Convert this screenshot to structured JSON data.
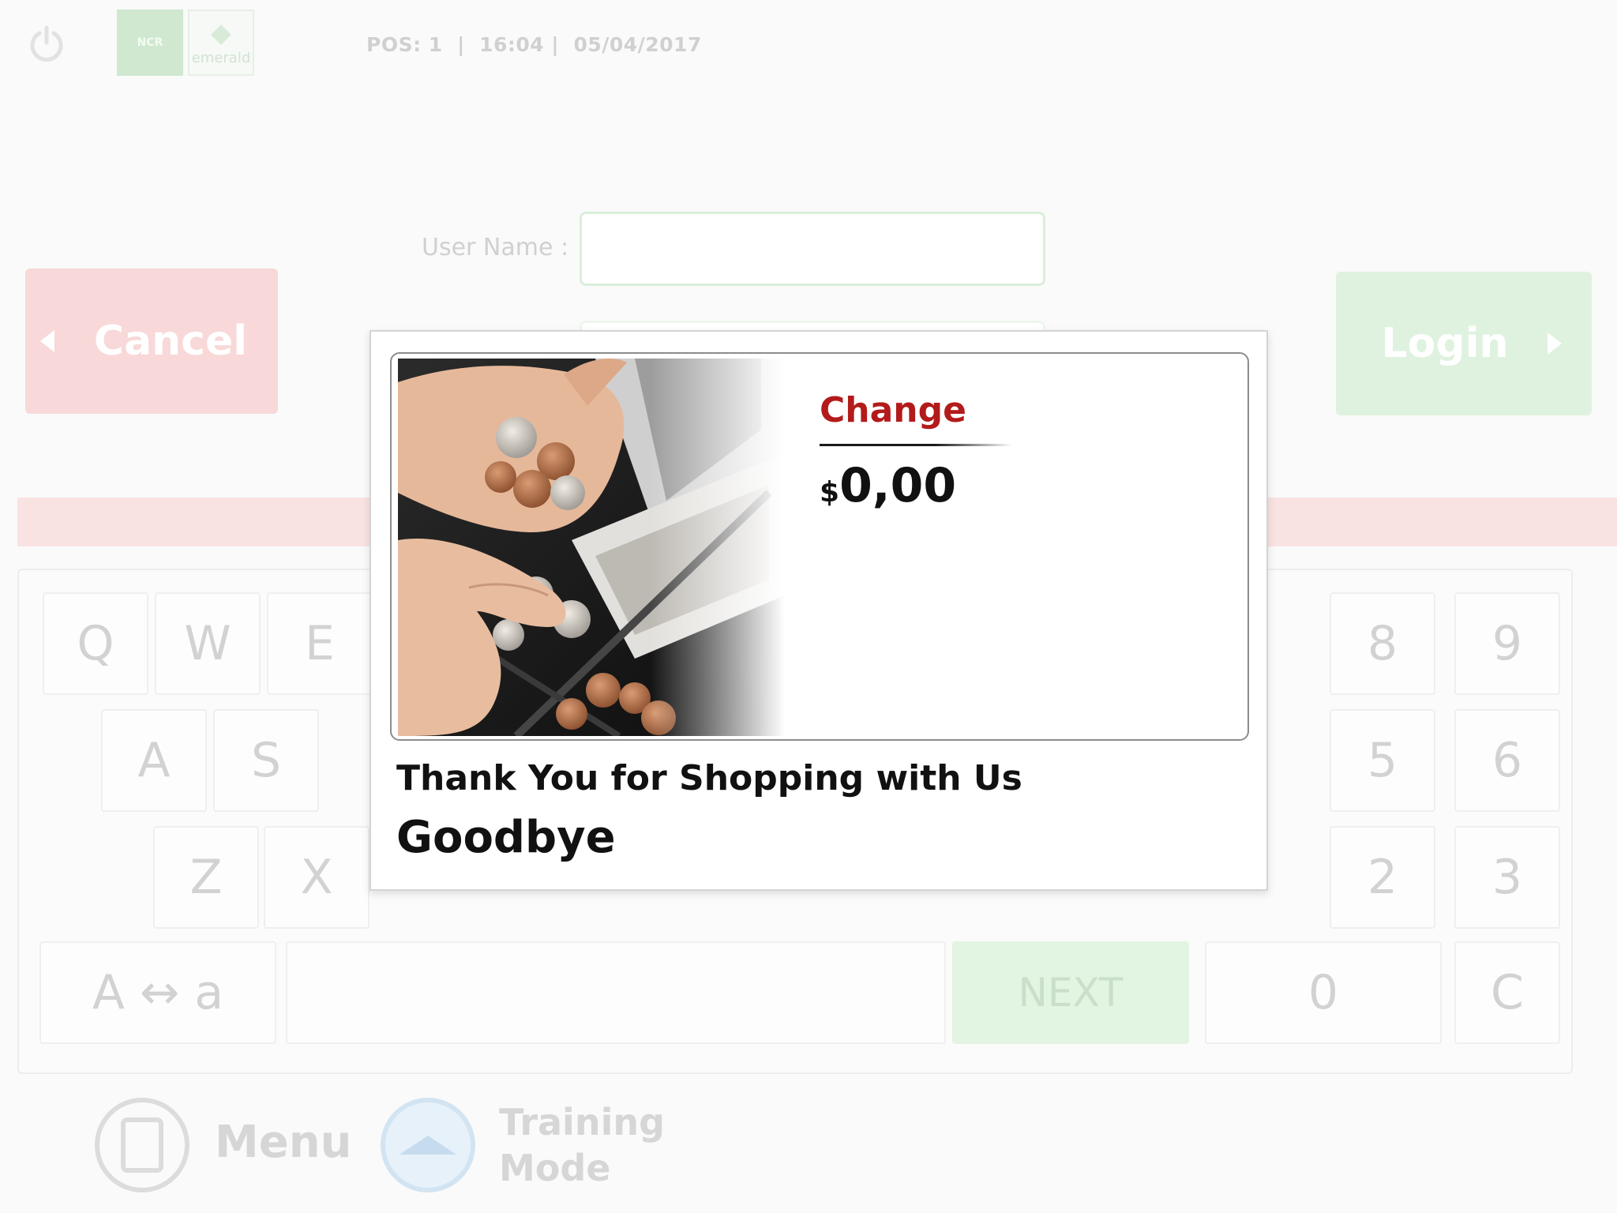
{
  "header": {
    "pos_info": "POS: 1  |  16:04 |  05/04/2017",
    "ncr_logo_text": "NCR",
    "emerald_logo_text": "emerald"
  },
  "login": {
    "username_label": "User Name :",
    "username_value": "",
    "cancel_label": "Cancel",
    "login_label": "Login"
  },
  "keyboard": {
    "row1": [
      "Q",
      "W",
      "E"
    ],
    "row2": [
      "A",
      "S"
    ],
    "row3": [
      "Z",
      "X"
    ],
    "numpad_row1": [
      "8",
      "9"
    ],
    "numpad_row2": [
      "5",
      "6"
    ],
    "numpad_row3": [
      "2",
      "3"
    ],
    "case_toggle": "A ↔ a",
    "next_label": "NEXT",
    "zero": "0",
    "clear": "C"
  },
  "footer": {
    "menu_label": "Menu",
    "training_label": "Training Mode"
  },
  "modal": {
    "change_label": "Change",
    "currency_symbol": "$",
    "change_amount": "0,00",
    "thanks_text": "Thank You for Shopping with Us",
    "goodbye_text": "Goodbye"
  },
  "colors": {
    "accent_red": "#b31b1b",
    "cancel_bg": "#f8d8d8",
    "login_bg": "#dff2df"
  }
}
